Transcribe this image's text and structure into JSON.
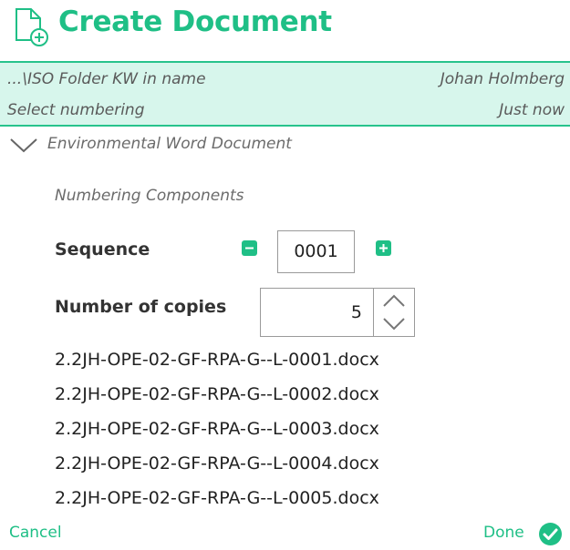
{
  "header": {
    "title": "Create Document",
    "icon": "new-document-icon"
  },
  "info": {
    "folder": "...\\ISO Folder KW in name",
    "author": "Johan Holmberg",
    "numbering_prompt": "Select numbering",
    "time": "Just now"
  },
  "template": {
    "name": "Environmental Word Document",
    "expand_icon": "chevron-down-icon"
  },
  "numbering": {
    "section_title": "Numbering Components",
    "sequence_label": "Sequence",
    "sequence_value": "0001",
    "copies_label": "Number of copies",
    "copies_value": "5"
  },
  "files": [
    "2.2JH-OPE-02-GF-RPA-G--L-0001.docx",
    "2.2JH-OPE-02-GF-RPA-G--L-0002.docx",
    "2.2JH-OPE-02-GF-RPA-G--L-0003.docx",
    "2.2JH-OPE-02-GF-RPA-G--L-0004.docx",
    "2.2JH-OPE-02-GF-RPA-G--L-0005.docx"
  ],
  "footer": {
    "cancel_label": "Cancel",
    "done_label": "Done"
  },
  "colors": {
    "accent": "#1fbf86",
    "band_bg": "#d7f6ec",
    "band_border": "#27c38c"
  }
}
